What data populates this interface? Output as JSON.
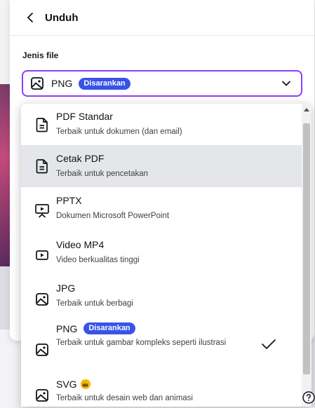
{
  "header": {
    "title": "Unduh"
  },
  "field": {
    "label": "Jenis file"
  },
  "select": {
    "value": "PNG",
    "badge": "Disarankan"
  },
  "options": [
    {
      "title": "PDF Standar",
      "subtitle": "Terbaik untuk dokumen (dan email)",
      "icon": "document-icon"
    },
    {
      "title": "Cetak PDF",
      "subtitle": "Terbaik untuk pencetakan",
      "icon": "document-icon"
    },
    {
      "title": "PPTX",
      "subtitle": "Dokumen Microsoft PowerPoint",
      "icon": "presentation-icon"
    },
    {
      "title": "Video MP4",
      "subtitle": "Video berkualitas tinggi",
      "icon": "video-icon"
    },
    {
      "title": "JPG",
      "subtitle": "Terbaik untuk berbagi",
      "icon": "image-icon"
    },
    {
      "title": "PNG",
      "badge": "Disarankan",
      "subtitle": "Terbaik untuk gambar kompleks seperti ilustrasi",
      "icon": "image-icon",
      "selected": true
    },
    {
      "title": "SVG",
      "subtitle": "Terbaik untuk desain web dan animasi",
      "icon": "image-icon",
      "premium": true
    }
  ],
  "colors": {
    "accent": "#8b3dff",
    "badge": "#3754e6",
    "crown": "#f5b800",
    "highlight": "#e5e6e9"
  }
}
